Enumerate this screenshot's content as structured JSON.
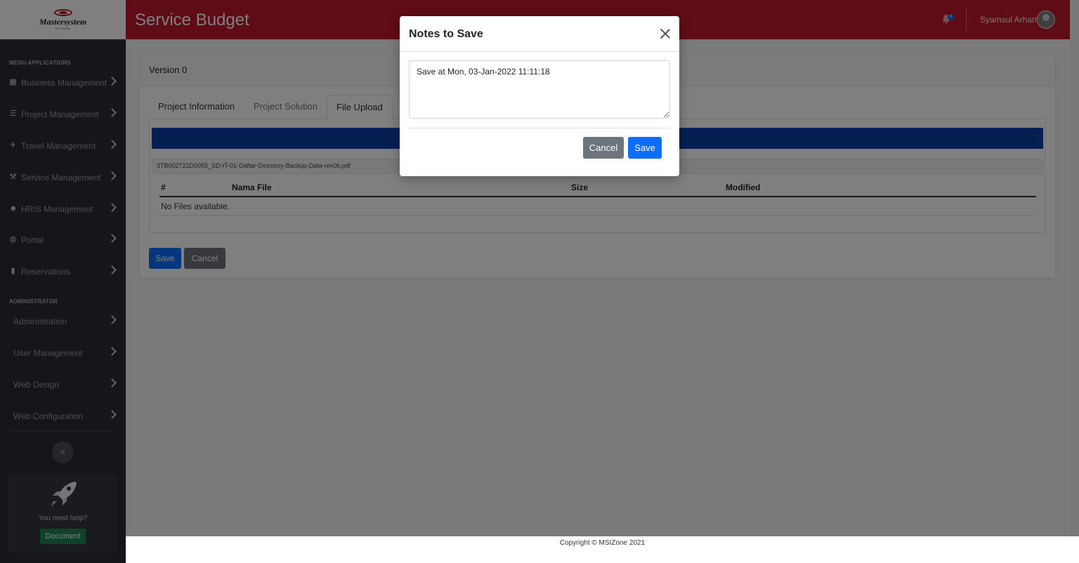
{
  "brand": {
    "name": "Mastersystem",
    "tagline": "ICT Solution"
  },
  "header": {
    "title": "Service Budget",
    "notification_count": "0",
    "username": "Syamsul Arham"
  },
  "sidebar": {
    "section1": "MENU APPLICATIONS",
    "items": [
      {
        "label": "Business Management",
        "icon": "building-icon"
      },
      {
        "label": "Project Management",
        "icon": "list-icon"
      },
      {
        "label": "Travel Management",
        "icon": "plane-icon"
      },
      {
        "label": "Service Management",
        "icon": "wrench-icon"
      },
      {
        "label": "HRIS Management",
        "icon": "users-icon"
      },
      {
        "label": "Portal",
        "icon": "globe-icon"
      },
      {
        "label": "Reservations",
        "icon": "bookmark-icon"
      }
    ],
    "section2": "ADMINISTRATOR",
    "admin_items": [
      {
        "label": "Administration"
      },
      {
        "label": "User Management"
      },
      {
        "label": "Web Design"
      },
      {
        "label": "Web Configuration"
      }
    ],
    "collapse_glyph": "<",
    "help_text": "You need help?",
    "document_label": "Document"
  },
  "main": {
    "version_title": "Version 0",
    "tabs": [
      {
        "label": "Project Information"
      },
      {
        "label": "Project Solution"
      },
      {
        "label": "File Upload"
      }
    ],
    "file_chip": "3TB002721D0055_SD-IT-01-Daftar-Directory-Backup-Data-rev06.pdf",
    "table": {
      "columns": [
        "#",
        "Nama File",
        "Size",
        "Modified"
      ],
      "empty_text": "No Files available."
    },
    "save_label": "Save",
    "cancel_label": "Cancel"
  },
  "footer": {
    "copyright": "Copyright © MSIZone 2021"
  },
  "modal": {
    "title": "Notes to Save",
    "notes_value": "Save at Mon, 03-Jan-2022 11:11:18",
    "cancel_label": "Cancel",
    "save_label": "Save"
  },
  "colors": {
    "topbar": "#c0192c",
    "sidebar": "#2b2d33",
    "primary": "#0d6efd",
    "secondary": "#6c757d",
    "success": "#198754",
    "banner": "#0d3fa6"
  }
}
